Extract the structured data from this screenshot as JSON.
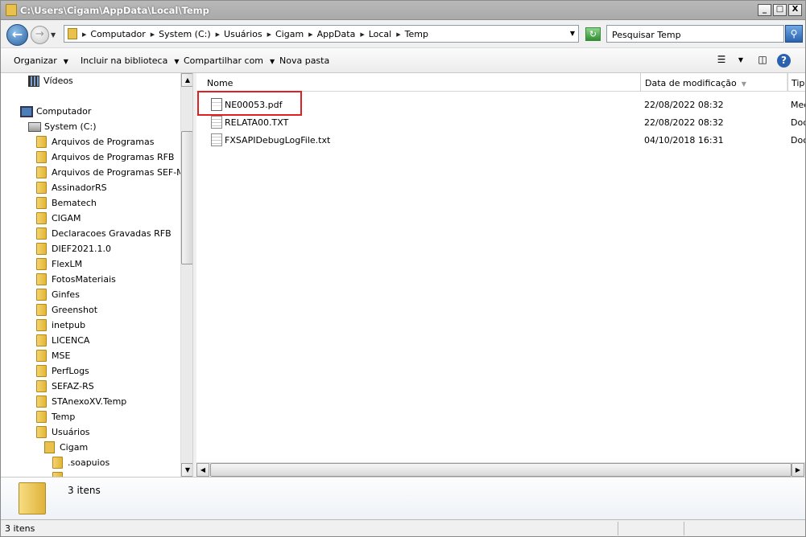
{
  "window": {
    "title": "C:\\Users\\Cigam\\AppData\\Local\\Temp",
    "buttons": {
      "minimize": "_",
      "maximize": "□",
      "close": "X"
    }
  },
  "address": {
    "crumbs": [
      "Computador",
      "System (C:)",
      "Usuários",
      "Cigam",
      "AppData",
      "Local",
      "Temp"
    ]
  },
  "search": {
    "placeholder": "Pesquisar Temp"
  },
  "toolbar": {
    "organize": "Organizar",
    "include": "Incluir na biblioteca",
    "share": "Compartilhar com",
    "new_folder": "Nova pasta"
  },
  "nav": {
    "videos": "Vídeos",
    "computer": "Computador",
    "drive": "System (C:)",
    "folders": [
      "Arquivos de Programas",
      "Arquivos de Programas RFB",
      "Arquivos de Programas SEF-MG",
      "AssinadorRS",
      "Bematech",
      "CIGAM",
      "Declaracoes Gravadas RFB",
      "DIEF2021.1.0",
      "FlexLM",
      "FotosMateriais",
      "Ginfes",
      "Greenshot",
      "inetpub",
      "LICENCA",
      "MSE",
      "PerfLogs",
      "SEFAZ-RS",
      "STAnexoXV.Temp",
      "Temp",
      "Usuários"
    ],
    "user": "Cigam",
    "subfolders": [
      ".soapuios"
    ]
  },
  "columns": {
    "name": "Nome",
    "date": "Data de modificação",
    "type": "Tipo"
  },
  "files": [
    {
      "name": "NE00053.pdf",
      "date": "22/08/2022 08:32",
      "type": "Med",
      "icon": "pdf-file-icon"
    },
    {
      "name": "RELATA00.TXT",
      "date": "22/08/2022 08:32",
      "type": "Doc",
      "icon": "text-file-icon"
    },
    {
      "name": "FXSAPIDebugLogFile.txt",
      "date": "04/10/2018 16:31",
      "type": "Doc",
      "icon": "text-file-icon"
    }
  ],
  "details": {
    "count": "3 itens"
  },
  "status": {
    "count": "3 itens"
  },
  "colors": {
    "highlight": "#e02020",
    "title_bar": "#b0b0b0"
  }
}
